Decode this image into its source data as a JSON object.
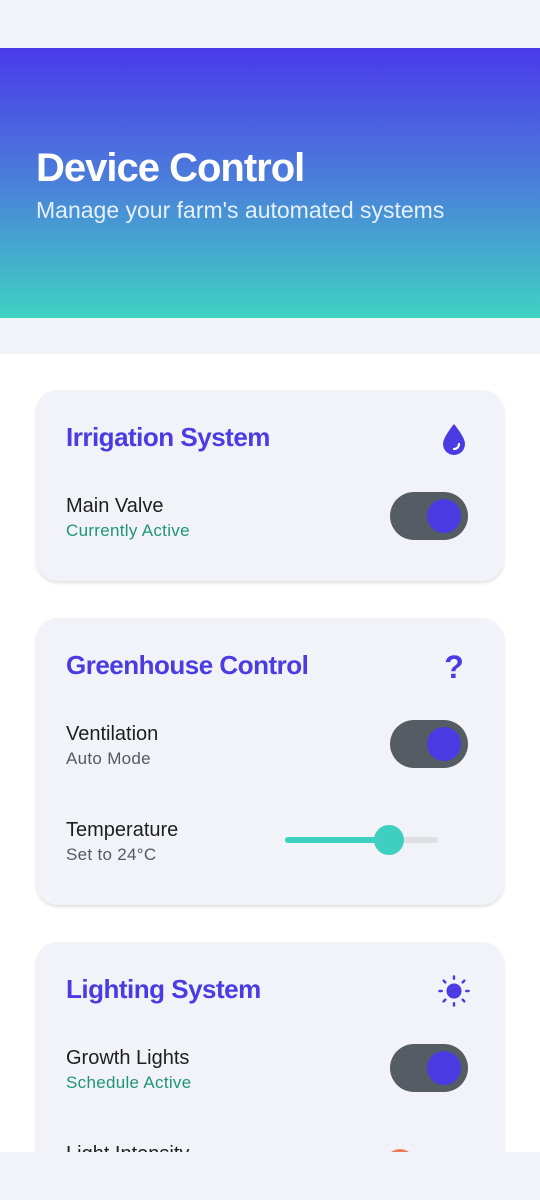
{
  "header": {
    "title": "Device Control",
    "subtitle": "Manage your farm's automated systems"
  },
  "colors": {
    "accent": "#4b3be3",
    "teal": "#3ecfc0",
    "toggle_track": "#565c64",
    "active_green": "#1f9673",
    "orange": "#e8825a"
  },
  "cards": [
    {
      "title": "Irrigation System",
      "icon": "water-drop-icon",
      "rows": [
        {
          "label": "Main Valve",
          "sub": "Currently Active",
          "control": "toggle",
          "on": true
        }
      ]
    },
    {
      "title": "Greenhouse Control",
      "icon": "question-mark-icon",
      "icon_glyph": "?",
      "rows": [
        {
          "label": "Ventilation",
          "sub": "Auto Mode",
          "control": "toggle",
          "on": true
        },
        {
          "label": "Temperature",
          "sub": "Set to 24°C",
          "control": "slider",
          "fraction": 0.68
        }
      ]
    },
    {
      "title": "Lighting System",
      "icon": "sun-icon",
      "rows": [
        {
          "label": "Growth Lights",
          "sub": "Schedule Active",
          "control": "toggle",
          "on": true
        },
        {
          "label": "Light Intensity",
          "control": "slider",
          "fraction": 0.75
        }
      ]
    }
  ]
}
